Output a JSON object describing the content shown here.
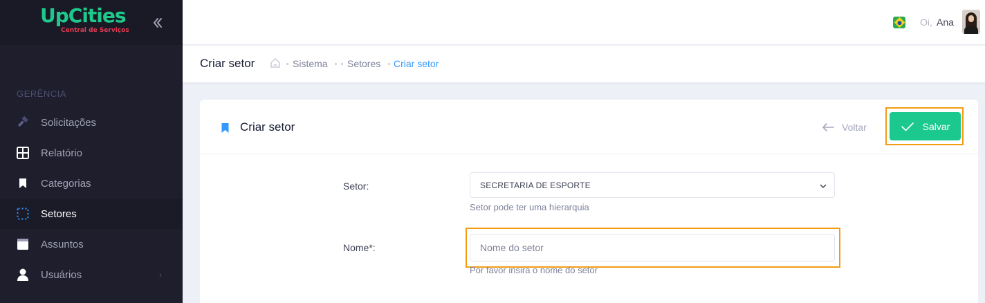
{
  "brand": {
    "name": "UpCities",
    "tagline": "Central de Serviços"
  },
  "sidebar": {
    "section": "GERÊNCIA",
    "items": [
      {
        "label": "Solicitações",
        "icon": "hammer-icon"
      },
      {
        "label": "Relatório",
        "icon": "grid-icon"
      },
      {
        "label": "Categorias",
        "icon": "bookmark-icon"
      },
      {
        "label": "Setores",
        "icon": "dotted-square-icon",
        "active": true
      },
      {
        "label": "Assuntos",
        "icon": "document-icon"
      },
      {
        "label": "Usuários",
        "icon": "user-icon",
        "has_submenu": true
      }
    ]
  },
  "topbar": {
    "greeting": "Oi,",
    "user_name": "Ana",
    "language_flag": "brazil-flag-icon"
  },
  "subheader": {
    "title": "Criar setor",
    "breadcrumb": [
      "Sistema",
      "Setores",
      "Criar setor"
    ]
  },
  "card": {
    "title": "Criar setor",
    "back_label": "Voltar",
    "save_label": "Salvar"
  },
  "form": {
    "setor": {
      "label": "Setor:",
      "value": "SECRETARIA DE ESPORTE",
      "help": "Setor pode ter uma hierarquia"
    },
    "nome": {
      "label": "Nome*:",
      "placeholder": "Nome do setor",
      "value": "",
      "help": "Por favor insira o nome do setor"
    }
  },
  "colors": {
    "accent_green": "#1bc98e",
    "highlight_orange": "#f39c12",
    "breadcrumb_active": "#3699ff",
    "sidebar_bg": "#1e1e2d"
  }
}
